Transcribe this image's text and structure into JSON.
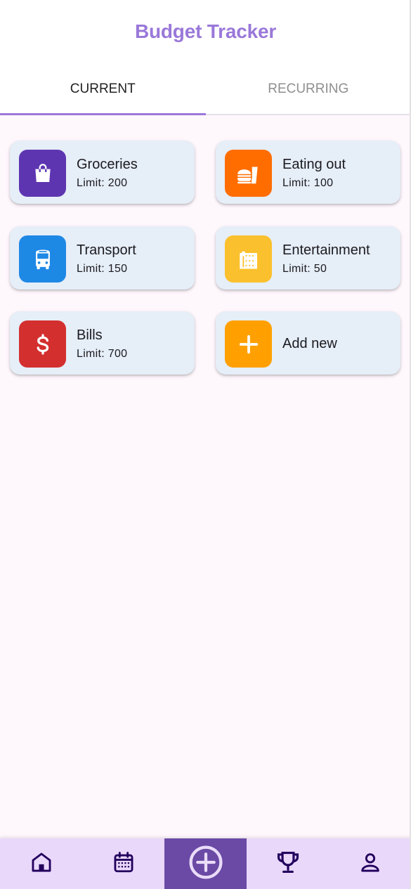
{
  "app": {
    "title": "Budget Tracker"
  },
  "tabs": [
    {
      "label": "CURRENT",
      "active": true
    },
    {
      "label": "RECURRING",
      "active": false
    }
  ],
  "categories": [
    {
      "name": "Groceries",
      "limit": "Limit: 200",
      "icon": "shopping-bag-icon",
      "color": "#5e35b1"
    },
    {
      "name": "Eating out",
      "limit": "Limit: 100",
      "icon": "fastfood-icon",
      "color": "#ff6d00"
    },
    {
      "name": "Transport",
      "limit": "Limit: 150",
      "icon": "bus-icon",
      "color": "#1e88e5"
    },
    {
      "name": "Entertainment",
      "limit": "Limit: 50",
      "icon": "film-icon",
      "color": "#fbc02d"
    },
    {
      "name": "Bills",
      "limit": "Limit: 700",
      "icon": "dollar-icon",
      "color": "#d32f2f"
    }
  ],
  "add_new": {
    "label": "Add new",
    "icon": "plus-icon",
    "color": "#ffa000"
  },
  "bottom_nav": [
    {
      "name": "home",
      "icon": "home-icon"
    },
    {
      "name": "calendar",
      "icon": "calendar-icon"
    },
    {
      "name": "add",
      "icon": "add-circle-icon",
      "selected": true
    },
    {
      "name": "trophy",
      "icon": "trophy-icon"
    },
    {
      "name": "profile",
      "icon": "person-icon"
    }
  ],
  "colors": {
    "accent": "#9a78d9",
    "nav_background": "#ead8fb",
    "nav_selected": "#6a4aa5",
    "card_background": "#e6eef8",
    "page_background": "#fef7fc"
  }
}
